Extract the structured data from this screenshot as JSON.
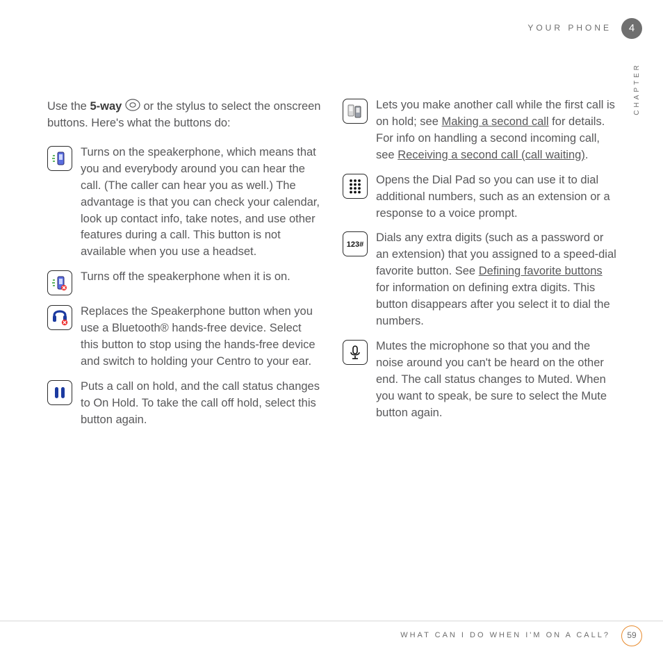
{
  "header": {
    "title": "YOUR PHONE",
    "chapter_num": "4",
    "chapter_label": "CHAPTER"
  },
  "footer": {
    "text": "WHAT CAN I DO WHEN I'M ON A CALL?",
    "page": "59"
  },
  "intro": {
    "pre": "Use the ",
    "bold": "5-way",
    "post": " or the stylus to select the onscreen buttons. Here's what the buttons do:"
  },
  "left": [
    {
      "icon": "speaker-on",
      "text": "Turns on the speakerphone, which means that you and everybody around you can hear the call. (The caller can hear you as well.) The advantage is that you can check your calendar, look up contact info, take notes, and use other features during a call. This button is not available when you use a headset."
    },
    {
      "icon": "speaker-off",
      "text": "Turns off the speakerphone when it is on."
    },
    {
      "icon": "bluetooth-cancel",
      "text": "Replaces the Speakerphone button when you use a Bluetooth® hands-free device. Select this button to stop using the hands-free device and switch to holding your Centro to your ear."
    },
    {
      "icon": "hold",
      "text": "Puts a call on hold, and the call status changes to On Hold. To take the call off hold, select this button again."
    }
  ],
  "right": [
    {
      "icon": "swap-calls",
      "parts": [
        {
          "t": "Lets you make another call while the first call is on hold; see "
        },
        {
          "t": "Making a second call",
          "link": true
        },
        {
          "t": " for details. For info on handling a second incoming call, see "
        },
        {
          "t": "Receiving a second call (call waiting)",
          "link": true
        },
        {
          "t": "."
        }
      ]
    },
    {
      "icon": "dialpad",
      "text": "Opens the Dial Pad so you can use it to dial additional numbers, such as an extension or a response to a voice prompt."
    },
    {
      "icon": "extra-digits",
      "parts": [
        {
          "t": "Dials any extra digits (such as a password or an extension) that you assigned to a speed-dial favorite button. See "
        },
        {
          "t": "Defining favorite buttons",
          "link": true
        },
        {
          "t": " for information on defining extra digits. This button disappears after you select it to dial the numbers."
        }
      ]
    },
    {
      "icon": "mute",
      "text": "Mutes the microphone so that you and the noise around you can't be heard on the other end. The call status changes to Muted. When you want to speak, be sure to select the Mute button again."
    }
  ]
}
